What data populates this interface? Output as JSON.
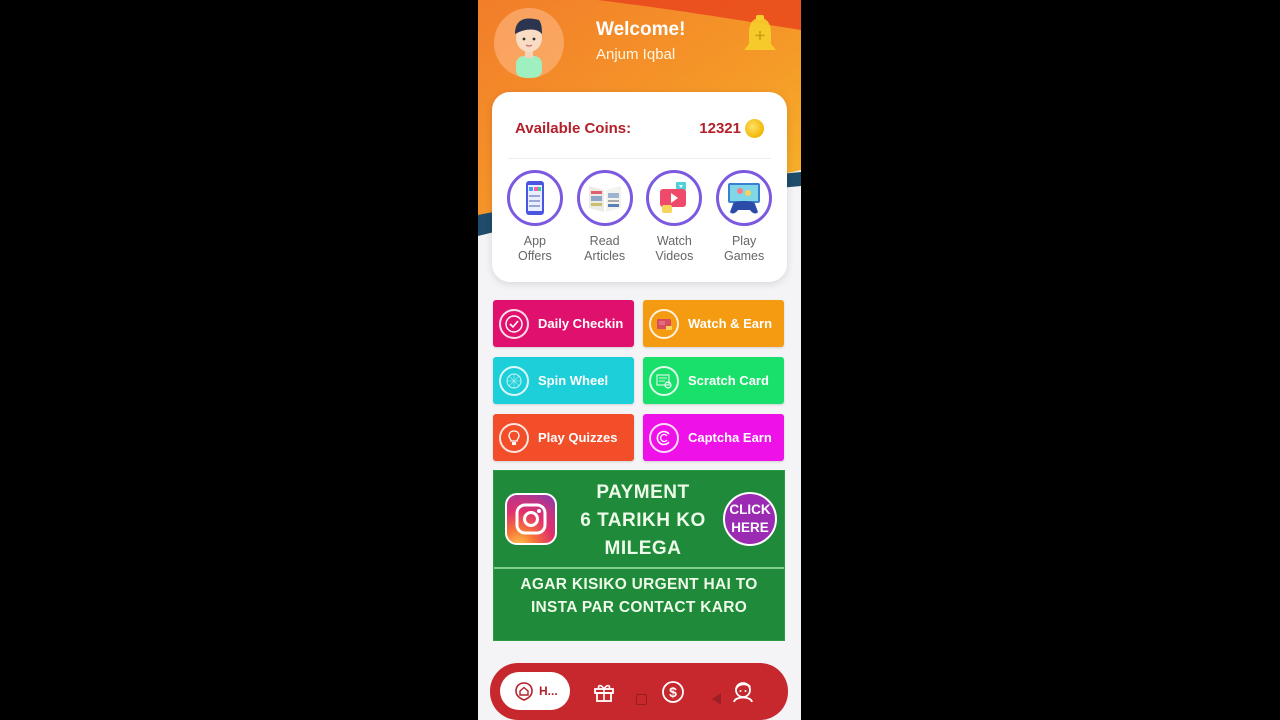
{
  "header": {
    "welcome": "Welcome!",
    "username": "Anjum Iqbal",
    "notification_icon": "bell-icon"
  },
  "coins_card": {
    "label": "Available Coins:",
    "value": "12321",
    "coin_icon": "coin-icon",
    "categories": [
      {
        "line1": "App",
        "line2": "Offers",
        "icon": "app-offers-icon"
      },
      {
        "line1": "Read",
        "line2": "Articles",
        "icon": "newspaper-icon"
      },
      {
        "line1": "Watch",
        "line2": "Videos",
        "icon": "video-play-icon"
      },
      {
        "line1": "Play",
        "line2": "Games",
        "icon": "gamepad-icon"
      }
    ]
  },
  "tiles": [
    {
      "label": "Daily Checkin",
      "color": "#e0116e",
      "icon": "check-circle-icon"
    },
    {
      "label": "Watch & Earn",
      "color": "#f49b12",
      "icon": "video-icon"
    },
    {
      "label": "Spin Wheel",
      "color": "#1ccfd8",
      "icon": "wheel-icon"
    },
    {
      "label": "Scratch Card",
      "color": "#18e06a",
      "icon": "scratch-card-icon"
    },
    {
      "label": "Play Quizzes",
      "color": "#f24e2a",
      "icon": "lightbulb-icon"
    },
    {
      "label": "Captcha Earn",
      "color": "#ee11e8",
      "icon": "captcha-icon"
    }
  ],
  "banner": {
    "title_lines": [
      "PAYMENT",
      "6 TARIKH KO",
      "MILEGA"
    ],
    "cta_lines": [
      "CLICK",
      "HERE"
    ],
    "sub_lines": [
      "AGAR KISIKO URGENT HAI TO",
      "INSTA PAR CONTACT KARO"
    ],
    "icon": "instagram-icon"
  },
  "bottom_nav": {
    "home_label": "H...",
    "items": [
      "home-icon",
      "gift-icon",
      "dollar-icon",
      "profile-icon"
    ]
  },
  "colors": {
    "accent_red": "#c6282e",
    "coins_text": "#b3202a",
    "category_ring": "#7b5ae0",
    "banner_green": "#1e8a3a"
  }
}
